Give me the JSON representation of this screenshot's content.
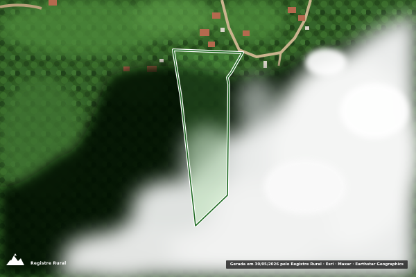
{
  "map": {
    "logo_label": "Registre Rural",
    "attribution": "Gerada em 30/05/2026 pelo Registre Rural · Esri · Maxar · Earthstar Geographics"
  },
  "colors": {
    "parcel_stroke": "#b8f0b0",
    "parcel_fill": "#7be36b",
    "vegetation": "#2f5a22",
    "cloud": "#f2f2f2"
  },
  "icons": {
    "logo": "mountain-logo-icon"
  }
}
